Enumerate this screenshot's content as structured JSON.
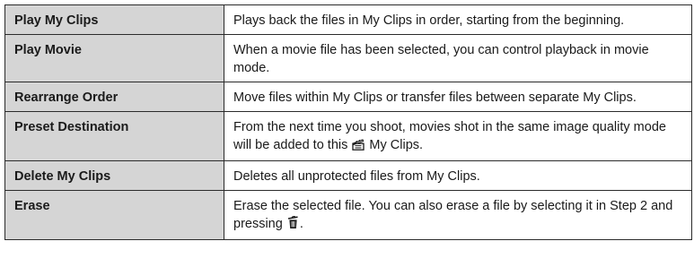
{
  "rows": [
    {
      "name": "Play My Clips",
      "description": "Plays back the files in My Clips in order, starting from the beginning."
    },
    {
      "name": "Play Movie",
      "description": "When a movie file has been selected, you can control playback in movie mode."
    },
    {
      "name": "Rearrange Order",
      "description": "Move files within My Clips or transfer files between separate My Clips."
    },
    {
      "name": "Preset Destination",
      "description_before_icon": "From the next time you shoot, movies shot in the same image quality mode will be added to this",
      "description_icon": "my-clips-icon",
      "description_after_icon": "My Clips."
    },
    {
      "name": "Delete My Clips",
      "description": "Deletes all unprotected files from My Clips."
    },
    {
      "name": "Erase",
      "description_before_icon": "Erase the selected file. You can also erase a file by selecting it in Step 2 and pressing",
      "description_icon": "erase-trash-icon",
      "description_after_icon": "."
    }
  ]
}
